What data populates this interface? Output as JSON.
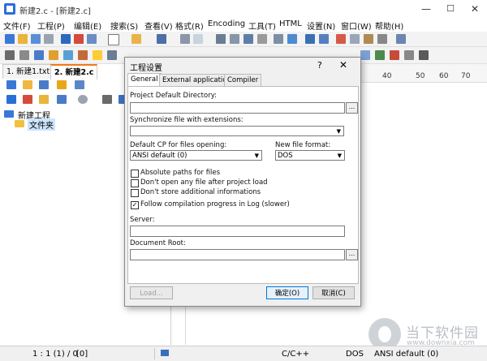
{
  "window": {
    "title": "新建2.c - [新建2.c]",
    "minimize": "—",
    "maximize": "☐",
    "close": "✕"
  },
  "menu": [
    "文件(F)",
    "工程(P)",
    "编辑(E)",
    "搜索(S)",
    "查看(V)",
    "格式(R)",
    "Encoding",
    "工具(T)",
    "HTML",
    "设置(N)",
    "窗口(W)",
    "帮助(H)"
  ],
  "doc_tabs": [
    "1. 新建1.txt",
    "2. 新建2.c"
  ],
  "project_tree": {
    "root": "新建工程",
    "child": "文件夹"
  },
  "ruler": [
    "40",
    "50",
    "60",
    "70"
  ],
  "status": {
    "position": "1 : 1 (1) / 0",
    "col": "[0]",
    "language": "C/C++",
    "line_ending": "DOS",
    "encoding": "ANSI default (0)"
  },
  "dialog": {
    "title": "工程设置",
    "help": "?",
    "close": "✕",
    "tabs": [
      "General",
      "External applications",
      "Compiler"
    ],
    "project_dir_label": "Project Default Directory:",
    "sync_label": "Synchronize file with extensions:",
    "default_cp_label": "Default CP for files opening:",
    "default_cp_value": "ANSI default (0)",
    "new_format_label": "New file format:",
    "new_format_value": "DOS",
    "browse": "...",
    "checkboxes": [
      {
        "label": "Absolute paths for files",
        "checked": false
      },
      {
        "label": "Don't open any file after project load",
        "checked": false
      },
      {
        "label": "Don't store additional informations",
        "checked": false
      },
      {
        "label": "Follow compilation progress in Log (slower)",
        "checked": true
      }
    ],
    "server_label": "Server:",
    "doc_root_label": "Document Root:",
    "load_button": "Load...",
    "ok_button": "确定(O)",
    "cancel_button": "取消(C)",
    "check_mark": "✓"
  },
  "watermark": {
    "line1": "当下软件园",
    "line2": "www.downxia.com"
  }
}
